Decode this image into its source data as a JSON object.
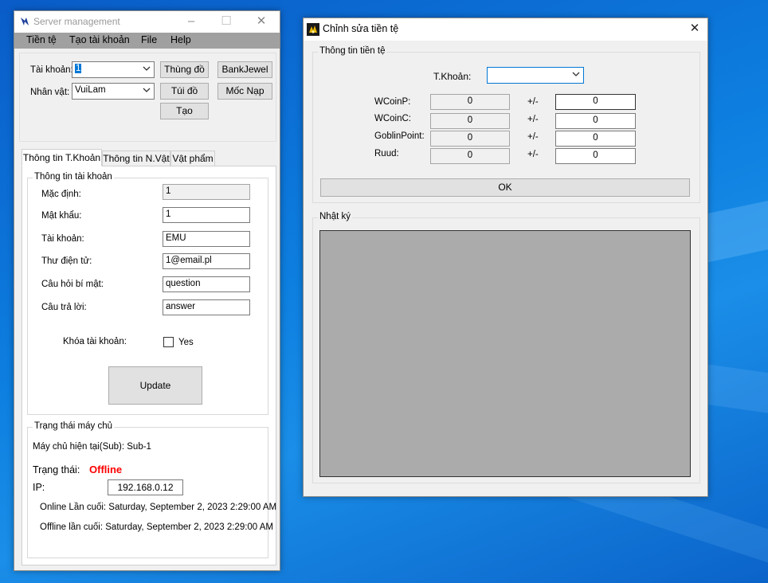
{
  "server_window": {
    "title": "Server management",
    "menu": [
      "Tiền tệ",
      "Tạo tài khoản",
      "File",
      "Help"
    ],
    "account_label": "Tài khoản:",
    "account_value": "1",
    "character_label": "Nhân vật:",
    "character_value": "VuiLam",
    "buttons": {
      "warehouse": "Thùng đồ",
      "bank_jewel": "BankJewel",
      "bag": "Túi đồ",
      "moc_nap": "Mốc Nạp",
      "create": "Tạo"
    },
    "tabs": [
      "Thông tin T.Khoản",
      "Thông tin N.Vật",
      "Vật phẩm"
    ],
    "account_info": {
      "group_title": "Thông tin tài khoản",
      "fields": [
        {
          "label": "Mặc định:",
          "value": "1"
        },
        {
          "label": "Mật khẩu:",
          "value": "1"
        },
        {
          "label": "Tài khoản:",
          "value": "EMU"
        },
        {
          "label": "Thư điện tử:",
          "value": "1@email.pl"
        },
        {
          "label": "Câu hỏi bí mật:",
          "value": "question"
        },
        {
          "label": "Câu trả lời:",
          "value": "answer"
        }
      ],
      "lock_label": "Khóa tài khoản:",
      "lock_checkbox_label": "Yes",
      "update_button": "Update"
    },
    "server_status": {
      "group_title": "Trạng thái máy chủ",
      "current_server": "Máy chủ hiện tại(Sub): Sub-1",
      "status_label": "Trạng thái:",
      "status_value": "Offline",
      "status_color": "#ff0000",
      "ip_label": "IP:",
      "ip_value": "192.168.0.12",
      "last_online": "Online Lần cuối: Saturday, September 2, 2023 2:29:00 AM",
      "last_offline": "Offline lần cuối: Saturday, September 2, 2023 2:29:00 AM"
    }
  },
  "currency_window": {
    "title": "Chỉnh sửa tiền tệ",
    "group_title": "Thông tin tiền tệ",
    "account_label": "T.Khoản:",
    "account_value": "",
    "rows": [
      {
        "label": "WCoinP:",
        "current": "0",
        "op": "+/-",
        "delta": "0"
      },
      {
        "label": "WCoinC:",
        "current": "0",
        "op": "+/-",
        "delta": "0"
      },
      {
        "label": "GoblinPoint:",
        "current": "0",
        "op": "+/-",
        "delta": "0"
      },
      {
        "label": "Ruud:",
        "current": "0",
        "op": "+/-",
        "delta": "0"
      }
    ],
    "ok_button": "OK",
    "log_title": "Nhật ký"
  }
}
